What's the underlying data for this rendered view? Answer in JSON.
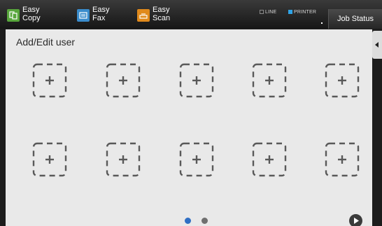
{
  "topbar": {
    "shortcuts": [
      {
        "line1": "Easy",
        "line2": "Copy",
        "icon": "copy-icon",
        "color": "#58a63c"
      },
      {
        "line1": "Easy",
        "line2": "Fax",
        "icon": "fax-icon",
        "color": "#3a8ccc"
      },
      {
        "line1": "Easy",
        "line2": "Scan",
        "icon": "scan-icon",
        "color": "#e08a1c"
      }
    ],
    "status_line": "LINE",
    "status_printer": "PRINTER",
    "job_status": "Job Status"
  },
  "main": {
    "title": "Add/Edit user",
    "slot_icon": "add-user-plus-icon",
    "slot_count": 10
  },
  "pager": {
    "current_page": 1,
    "total_pages": 2,
    "active_color": "#2f6fc4"
  }
}
